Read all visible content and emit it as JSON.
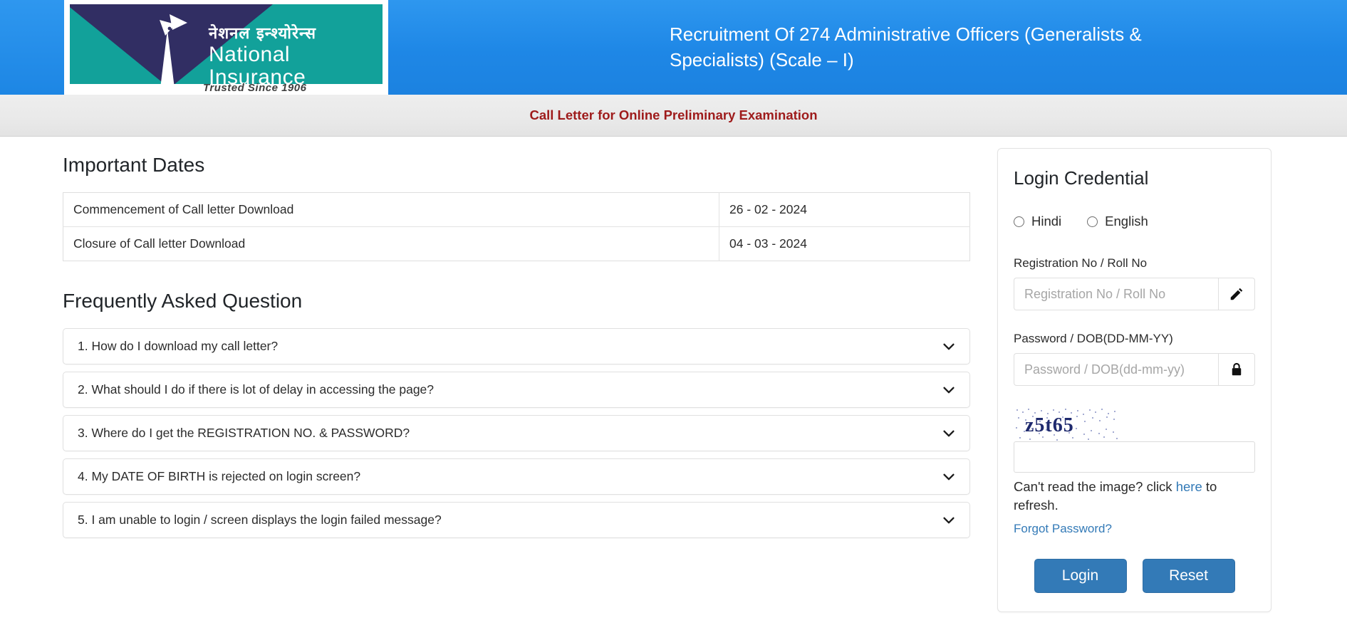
{
  "header": {
    "logo": {
      "hindi_name": "नेशनल इन्श्योरेन्स",
      "english_name": "National Insurance",
      "tagline": "Trusted Since 1906",
      "icon": "peacock-logo-icon"
    },
    "title": "Recruitment Of 274 Administrative Officers (Generalists & Specialists) (Scale – I)",
    "subtitle": "Call Letter for Online Preliminary Examination"
  },
  "important_dates": {
    "heading": "Important Dates",
    "rows": [
      {
        "label": "Commencement of Call letter Download",
        "value": "26 - 02 - 2024"
      },
      {
        "label": "Closure of Call letter Download",
        "value": "04 - 03 - 2024"
      }
    ]
  },
  "faq": {
    "heading": "Frequently Asked Question",
    "items": [
      {
        "question": "1. How do I download my call letter?"
      },
      {
        "question": "2. What should I do if there is lot of delay in accessing the page?"
      },
      {
        "question": "3. Where do I get the REGISTRATION NO. & PASSWORD?"
      },
      {
        "question": "4. My DATE OF BIRTH is rejected on login screen?"
      },
      {
        "question": "5. I am unable to login / screen displays the login failed message?"
      }
    ]
  },
  "login": {
    "heading": "Login Credential",
    "language_options": [
      {
        "label": "Hindi",
        "selected": false
      },
      {
        "label": "English",
        "selected": false
      }
    ],
    "registration": {
      "label": "Registration No / Roll No",
      "placeholder": "Registration No / Roll No",
      "value": "",
      "addon_icon": "pencil-icon"
    },
    "password": {
      "label": "Password / DOB(DD-MM-YY)",
      "placeholder": "Password / DOB(dd-mm-yy)",
      "value": "",
      "addon_icon": "lock-icon"
    },
    "captcha": {
      "text": "z5t65",
      "value": "",
      "placeholder": "",
      "refresh_prefix": "Can't read the image? click ",
      "refresh_link": "here",
      "refresh_suffix": " to refresh."
    },
    "forgot_password_label": "Forgot Password?",
    "login_button_label": "Login",
    "reset_button_label": "Reset"
  },
  "colors": {
    "header_blue": "#1e87e6",
    "logo_teal": "#12a19a",
    "logo_navy": "#312e63",
    "subtitle_red": "#9e1b1b",
    "link_blue": "#337ab7",
    "captcha_ink": "#1f2a6e"
  }
}
